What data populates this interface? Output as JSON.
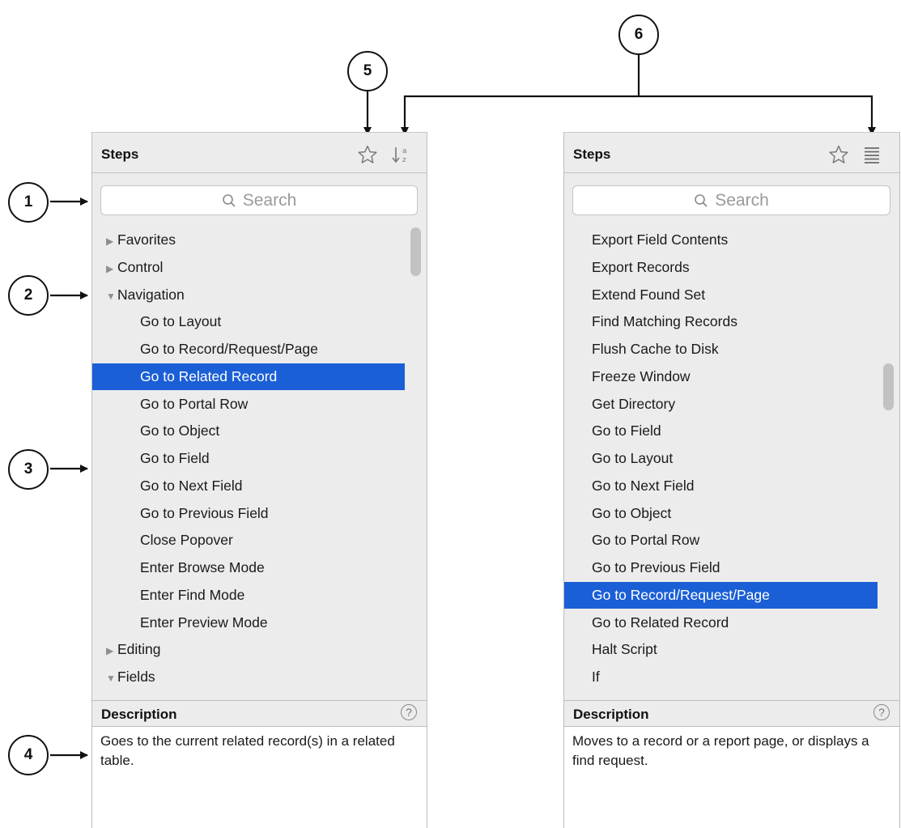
{
  "callouts": [
    "1",
    "2",
    "3",
    "4",
    "5",
    "6"
  ],
  "left_panel": {
    "title": "Steps",
    "icons": [
      "star-icon",
      "sort-az-icon"
    ],
    "search_placeholder": "Search",
    "items": [
      {
        "label": "Favorites",
        "type": "group",
        "expanded": false
      },
      {
        "label": "Control",
        "type": "group",
        "expanded": false
      },
      {
        "label": "Navigation",
        "type": "group",
        "expanded": true
      },
      {
        "label": "Go to Layout",
        "type": "step"
      },
      {
        "label": "Go to Record/Request/Page",
        "type": "step"
      },
      {
        "label": "Go to Related Record",
        "type": "step",
        "selected": true
      },
      {
        "label": "Go to Portal Row",
        "type": "step"
      },
      {
        "label": "Go to Object",
        "type": "step"
      },
      {
        "label": "Go to Field",
        "type": "step"
      },
      {
        "label": "Go to Next Field",
        "type": "step"
      },
      {
        "label": "Go to Previous Field",
        "type": "step"
      },
      {
        "label": "Close Popover",
        "type": "step"
      },
      {
        "label": "Enter Browse Mode",
        "type": "step"
      },
      {
        "label": "Enter Find Mode",
        "type": "step"
      },
      {
        "label": "Enter Preview Mode",
        "type": "step"
      },
      {
        "label": "Editing",
        "type": "group",
        "expanded": false
      },
      {
        "label": "Fields",
        "type": "group",
        "expanded": true
      }
    ],
    "description_title": "Description",
    "help_label": "?",
    "description": "Goes to the current related record(s) in a related table."
  },
  "right_panel": {
    "title": "Steps",
    "icons": [
      "star-icon",
      "list-view-icon"
    ],
    "search_placeholder": "Search",
    "items": [
      {
        "label": "Export Field Contents"
      },
      {
        "label": "Export Records"
      },
      {
        "label": "Extend Found Set"
      },
      {
        "label": "Find Matching Records"
      },
      {
        "label": "Flush Cache to Disk"
      },
      {
        "label": "Freeze Window"
      },
      {
        "label": "Get Directory"
      },
      {
        "label": "Go to Field"
      },
      {
        "label": "Go to Layout"
      },
      {
        "label": "Go to Next Field"
      },
      {
        "label": "Go to Object"
      },
      {
        "label": "Go to Portal Row"
      },
      {
        "label": "Go to Previous Field"
      },
      {
        "label": "Go to Record/Request/Page",
        "selected": true
      },
      {
        "label": "Go to Related Record"
      },
      {
        "label": "Halt Script"
      },
      {
        "label": "If"
      }
    ],
    "description_title": "Description",
    "help_label": "?",
    "description": "Moves to a record or a report page, or displays a find request."
  }
}
